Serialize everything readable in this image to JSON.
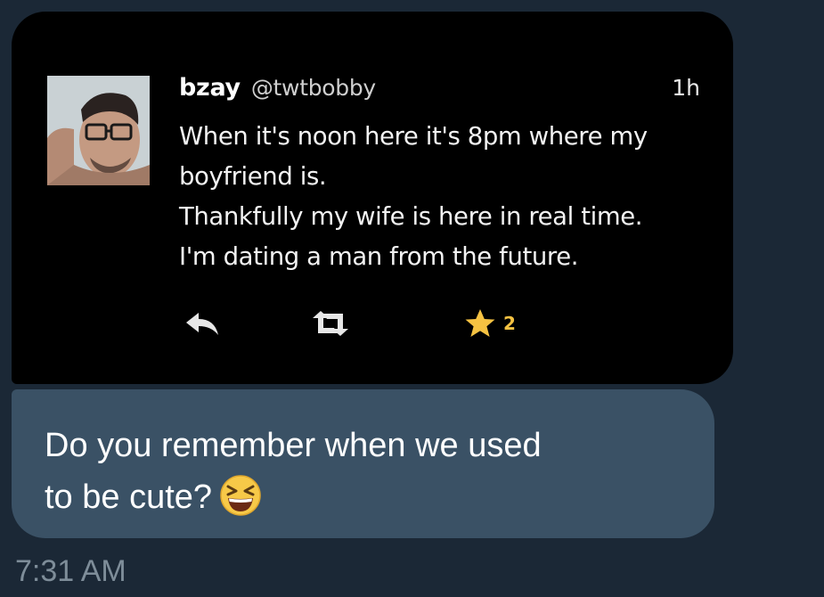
{
  "tweet": {
    "display_name": "bzay",
    "handle": "@twtbobby",
    "time": "1h",
    "lines": [
      "When it's noon here it's 8pm where my",
      "boyfriend is.",
      "Thankfully my wife is here in real time.",
      "I'm dating a man from the future."
    ],
    "actions": {
      "reply_icon": "reply-icon",
      "retweet_icon": "retweet-icon",
      "favorite_icon": "star-icon",
      "favorite_count": "2"
    }
  },
  "message": {
    "lines": [
      "Do you remember when we used",
      "to be cute?"
    ],
    "emoji": "grinning-squinting-face-emoji"
  },
  "timestamp": "7:31 AM",
  "colors": {
    "background": "#1b2836",
    "message_bubble": "#3a5165",
    "favorite_star": "#f5c242",
    "timestamp_text": "#7e8d99"
  }
}
